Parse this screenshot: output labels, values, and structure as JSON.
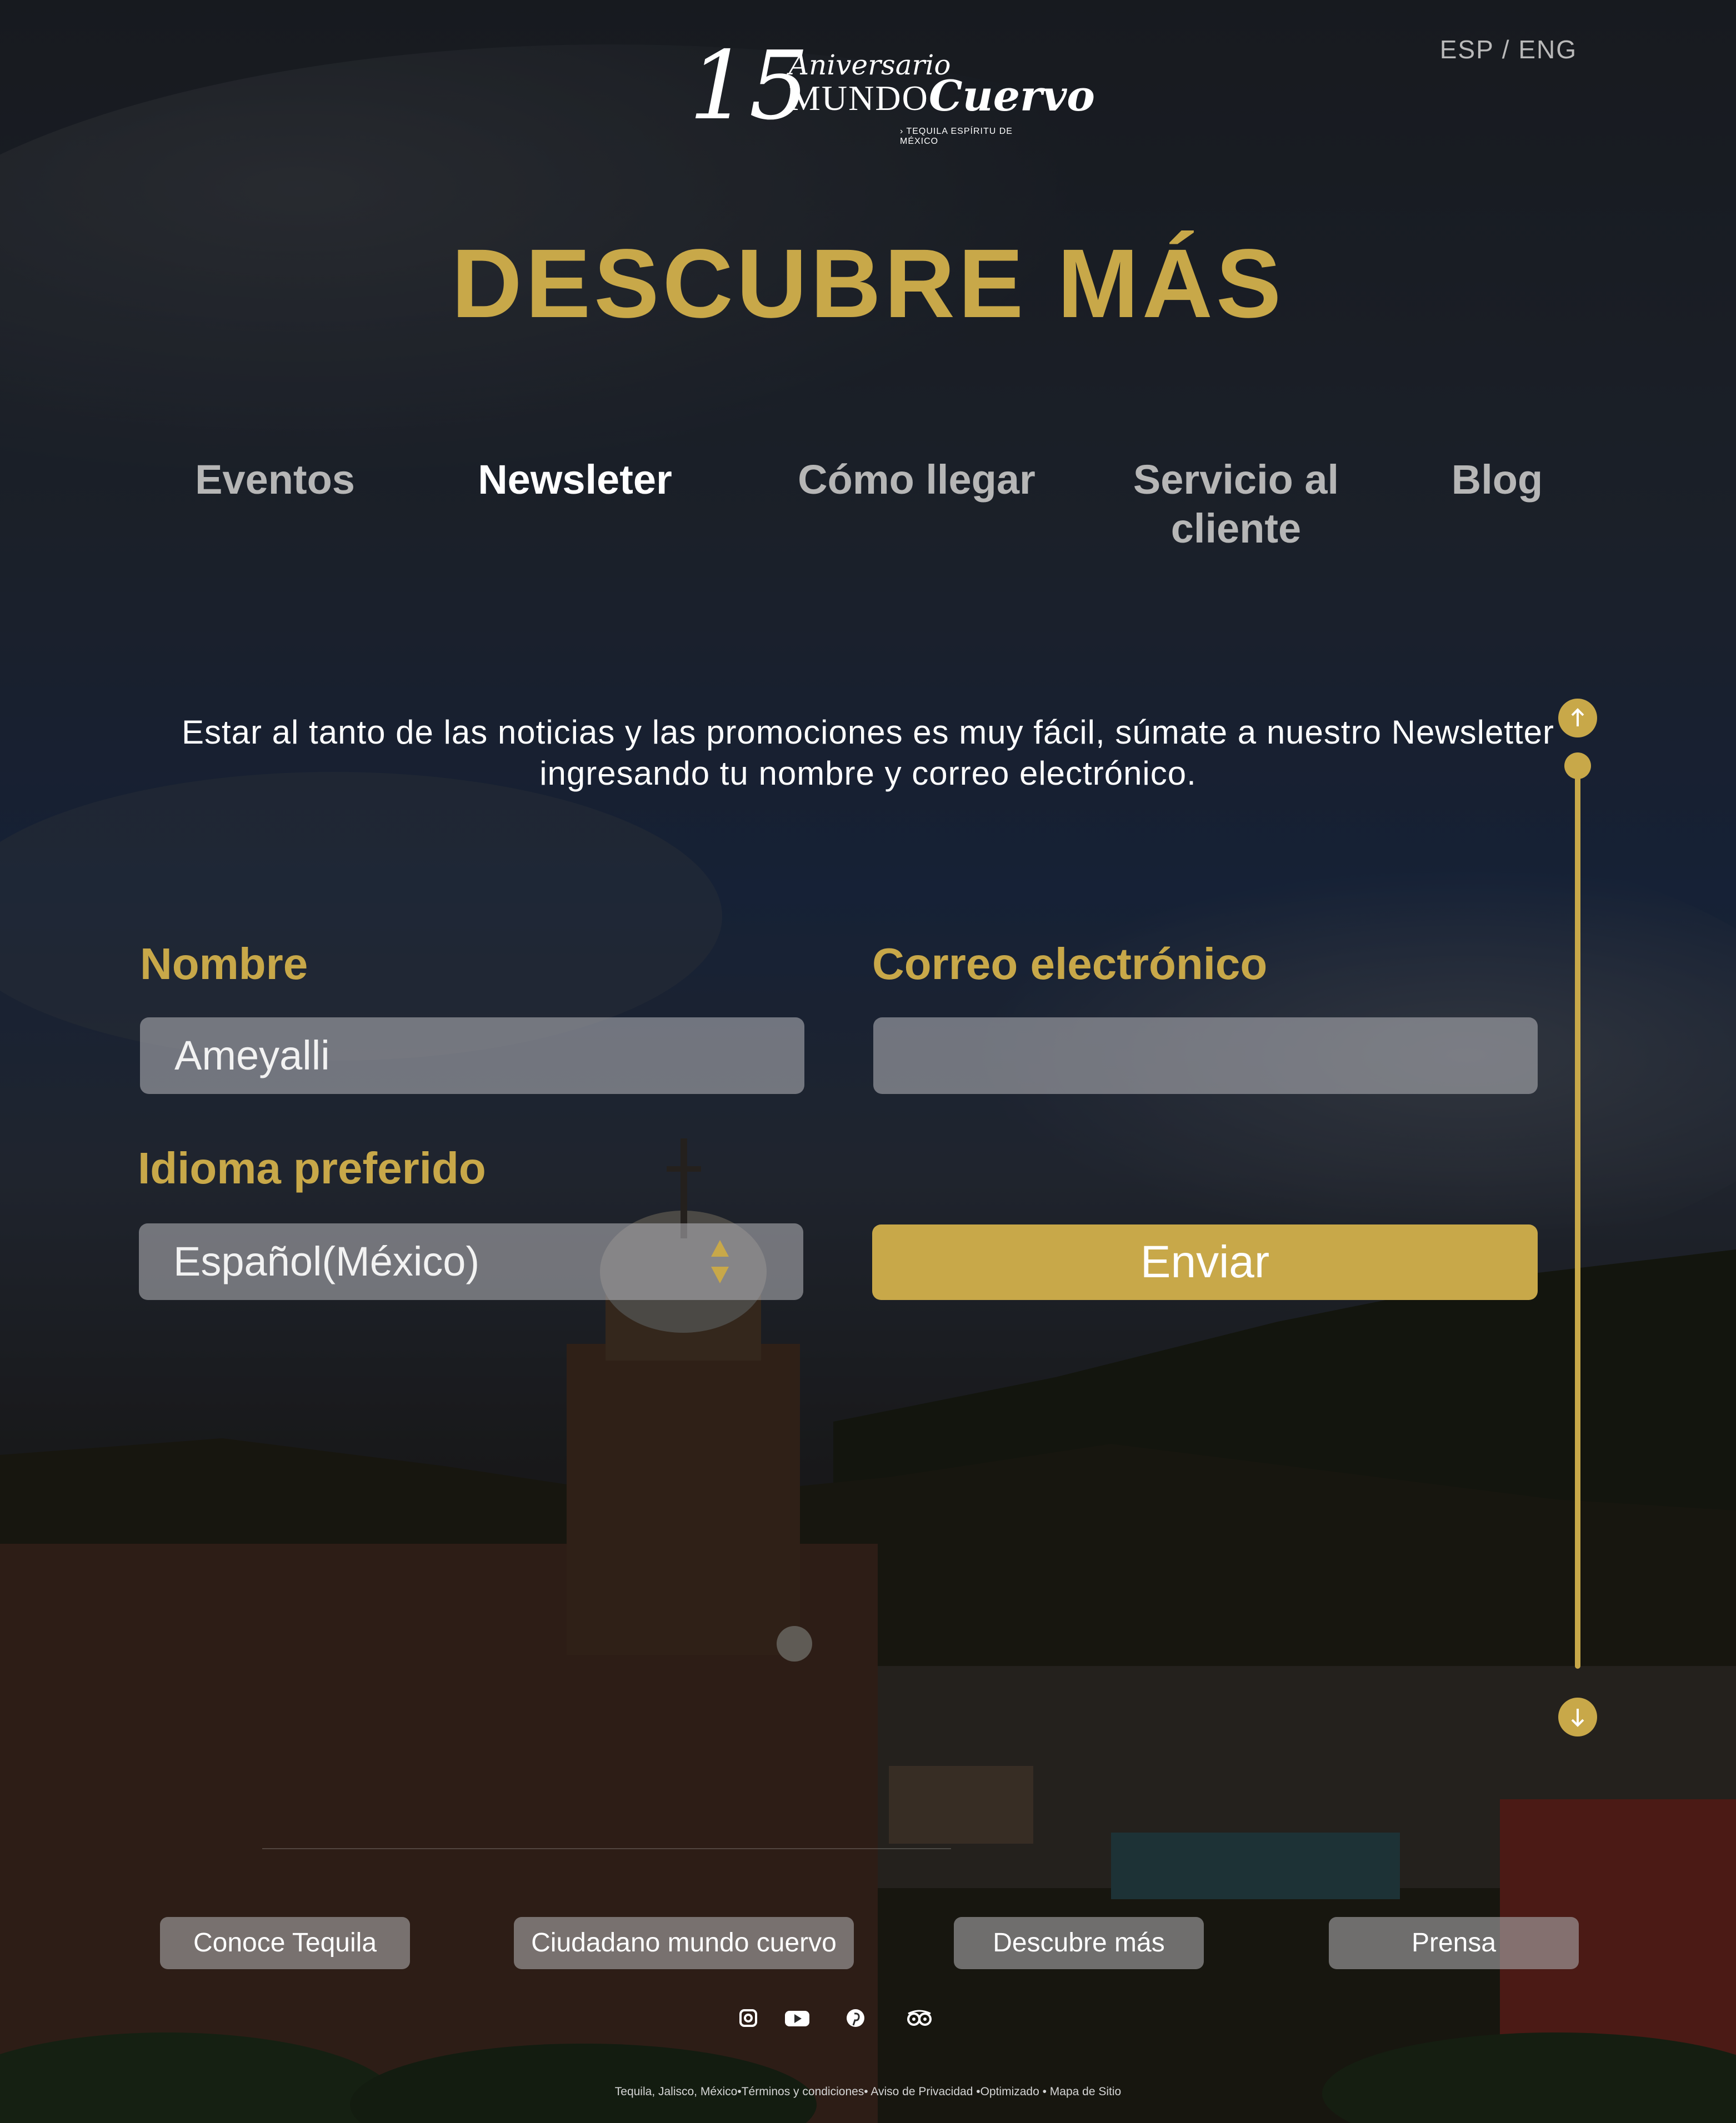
{
  "header": {
    "lang_esp": "ESP",
    "lang_sep": " / ",
    "lang_eng": "ENG",
    "logo": {
      "number": "15",
      "aniversario": "Aniversario",
      "mundo": "MUNDO",
      "brand": "Cuervo",
      "tagline": "› TEQUILA ESPÍRITU DE MÉXICO"
    }
  },
  "title": "DESCUBRE MÁS",
  "tabs": [
    {
      "label": "Eventos",
      "active": false
    },
    {
      "label": "Newsleter",
      "active": true
    },
    {
      "label": "Cómo llegar",
      "active": false
    },
    {
      "label": "Servicio al cliente",
      "active": false
    },
    {
      "label": "Blog",
      "active": false
    }
  ],
  "intro": "Estar al tanto de las noticias y las promociones es muy fácil, súmate a nuestro Newsletter ingresando tu nombre y correo electrónico.",
  "form": {
    "nombre_label": "Nombre",
    "nombre_value": "Ameyalli",
    "correo_label": "Correo electrónico",
    "correo_value": "",
    "idioma_label": "Idioma preferido",
    "idioma_value": "Español(México)",
    "submit_label": "Enviar"
  },
  "scroll": {
    "up_icon": "arrow-up-icon",
    "down_icon": "arrow-down-icon"
  },
  "footer": {
    "links": [
      {
        "label": "Conoce Tequila"
      },
      {
        "label": "Ciudadano mundo cuervo"
      },
      {
        "label": "Descubre más"
      },
      {
        "label": "Prensa"
      }
    ],
    "social_icons": [
      "instagram-icon",
      "youtube-icon",
      "pinterest-icon",
      "tripadvisor-icon"
    ],
    "legal": "Tequila, Jalisco, México•Términos y condiciones• Aviso de Privacidad •Optimizado • Mapa de Sitio"
  },
  "colors": {
    "gold": "#c8a849",
    "white": "#ffffff",
    "muted_tab": "#b6b6b6"
  }
}
